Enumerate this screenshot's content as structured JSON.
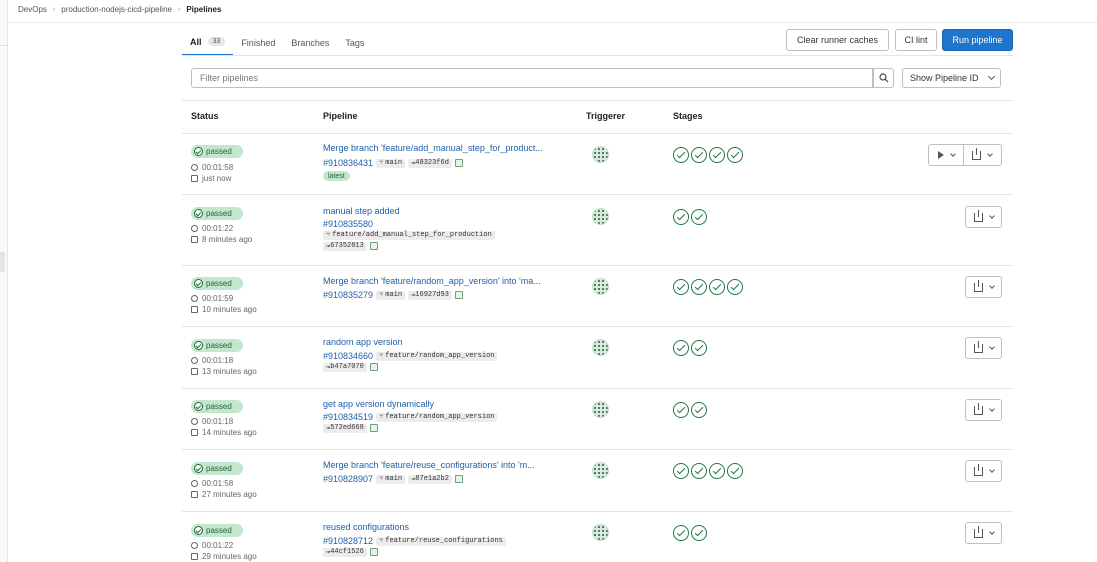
{
  "breadcrumb": [
    "DevOps",
    "production-nodejs-cicd-pipeline",
    "Pipelines"
  ],
  "tabs": [
    {
      "label": "All",
      "count": "33"
    },
    {
      "label": "Finished"
    },
    {
      "label": "Branches"
    },
    {
      "label": "Tags"
    }
  ],
  "buttons": {
    "clear_caches": "Clear runner caches",
    "ci_lint": "CI lint",
    "run_pipeline": "Run pipeline"
  },
  "filter": {
    "placeholder": "Filter pipelines"
  },
  "show_id": "Show Pipeline ID",
  "columns": [
    "Status",
    "Pipeline",
    "Triggerer",
    "Stages"
  ],
  "rows": [
    {
      "status": "passed",
      "duration": "00:01:58",
      "time": "just now",
      "title": "Merge branch 'feature/add_manual_step_for_product...",
      "id": "#910836431",
      "ref": "main",
      "sha": "48323f6d",
      "latest": "latest",
      "stages": 4,
      "play": true
    },
    {
      "status": "passed",
      "duration": "00:01:22",
      "time": "8 minutes ago",
      "title": "manual step added",
      "id": "#910835580",
      "ref": "feature/add_manual_step_for_production",
      "sha": "67352813",
      "stages": 2
    },
    {
      "status": "passed",
      "duration": "00:01:59",
      "time": "10 minutes ago",
      "title": "Merge branch 'feature/random_app_version' into 'ma...",
      "id": "#910835279",
      "ref": "main",
      "sha": "16927d93",
      "stages": 4
    },
    {
      "status": "passed",
      "duration": "00:01:18",
      "time": "13 minutes ago",
      "title": "random app version",
      "id": "#910834660",
      "ref": "feature/random_app_version",
      "sha": "b47a7070",
      "stages": 2
    },
    {
      "status": "passed",
      "duration": "00:01:18",
      "time": "14 minutes ago",
      "title": "get app version dynamically",
      "id": "#910834519",
      "ref": "feature/random_app_version",
      "sha": "572ed668",
      "stages": 2
    },
    {
      "status": "passed",
      "duration": "00:01:58",
      "time": "27 minutes ago",
      "title": "Merge branch 'feature/reuse_configurations' into 'm...",
      "id": "#910828907",
      "ref": "main",
      "sha": "87e1a2b2",
      "stages": 4
    },
    {
      "status": "passed",
      "duration": "00:01:22",
      "time": "29 minutes ago",
      "title": "reused configurations",
      "id": "#910828712",
      "ref": "feature/reuse_configurations",
      "sha": "44cf1526",
      "stages": 2
    }
  ]
}
